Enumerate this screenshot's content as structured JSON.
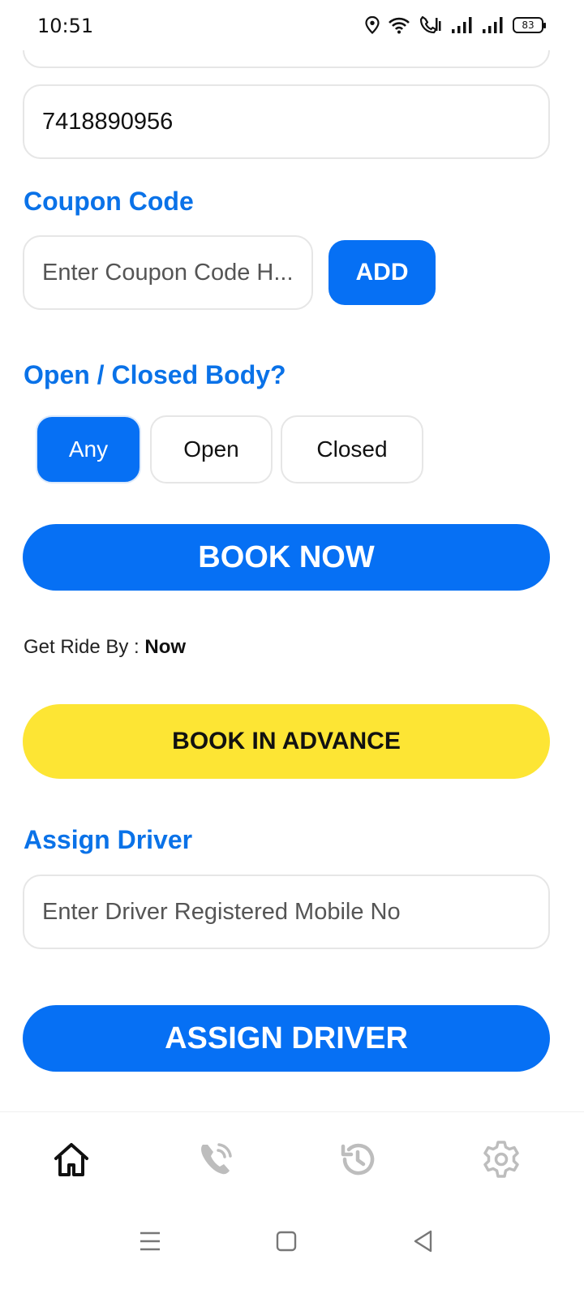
{
  "status_bar": {
    "time": "10:51",
    "battery": "83",
    "icons": [
      "location-icon",
      "wifi-icon",
      "wifi-call-icon",
      "signal-1-icon",
      "signal-2-icon",
      "battery-icon"
    ]
  },
  "form": {
    "mobile_value": "7418890956",
    "coupon": {
      "label": "Coupon Code",
      "placeholder": "Enter Coupon Code H...",
      "add_label": "ADD"
    },
    "body_type": {
      "label": "Open / Closed Body?",
      "options": [
        "Any",
        "Open",
        "Closed"
      ],
      "selected": "Any"
    },
    "book_now_label": "BOOK NOW",
    "ride_by": {
      "prefix": "Get Ride By : ",
      "value": "Now"
    },
    "book_advance_label": "BOOK IN ADVANCE",
    "assign_driver": {
      "label": "Assign Driver",
      "placeholder": "Enter Driver Registered Mobile No",
      "button_label": "ASSIGN DRIVER"
    }
  },
  "bottom_nav": {
    "items": [
      "home-icon",
      "phone-call-icon",
      "history-icon",
      "settings-icon"
    ],
    "active": "home-icon"
  },
  "system_nav": [
    "menu-icon",
    "square-icon",
    "back-icon"
  ]
}
